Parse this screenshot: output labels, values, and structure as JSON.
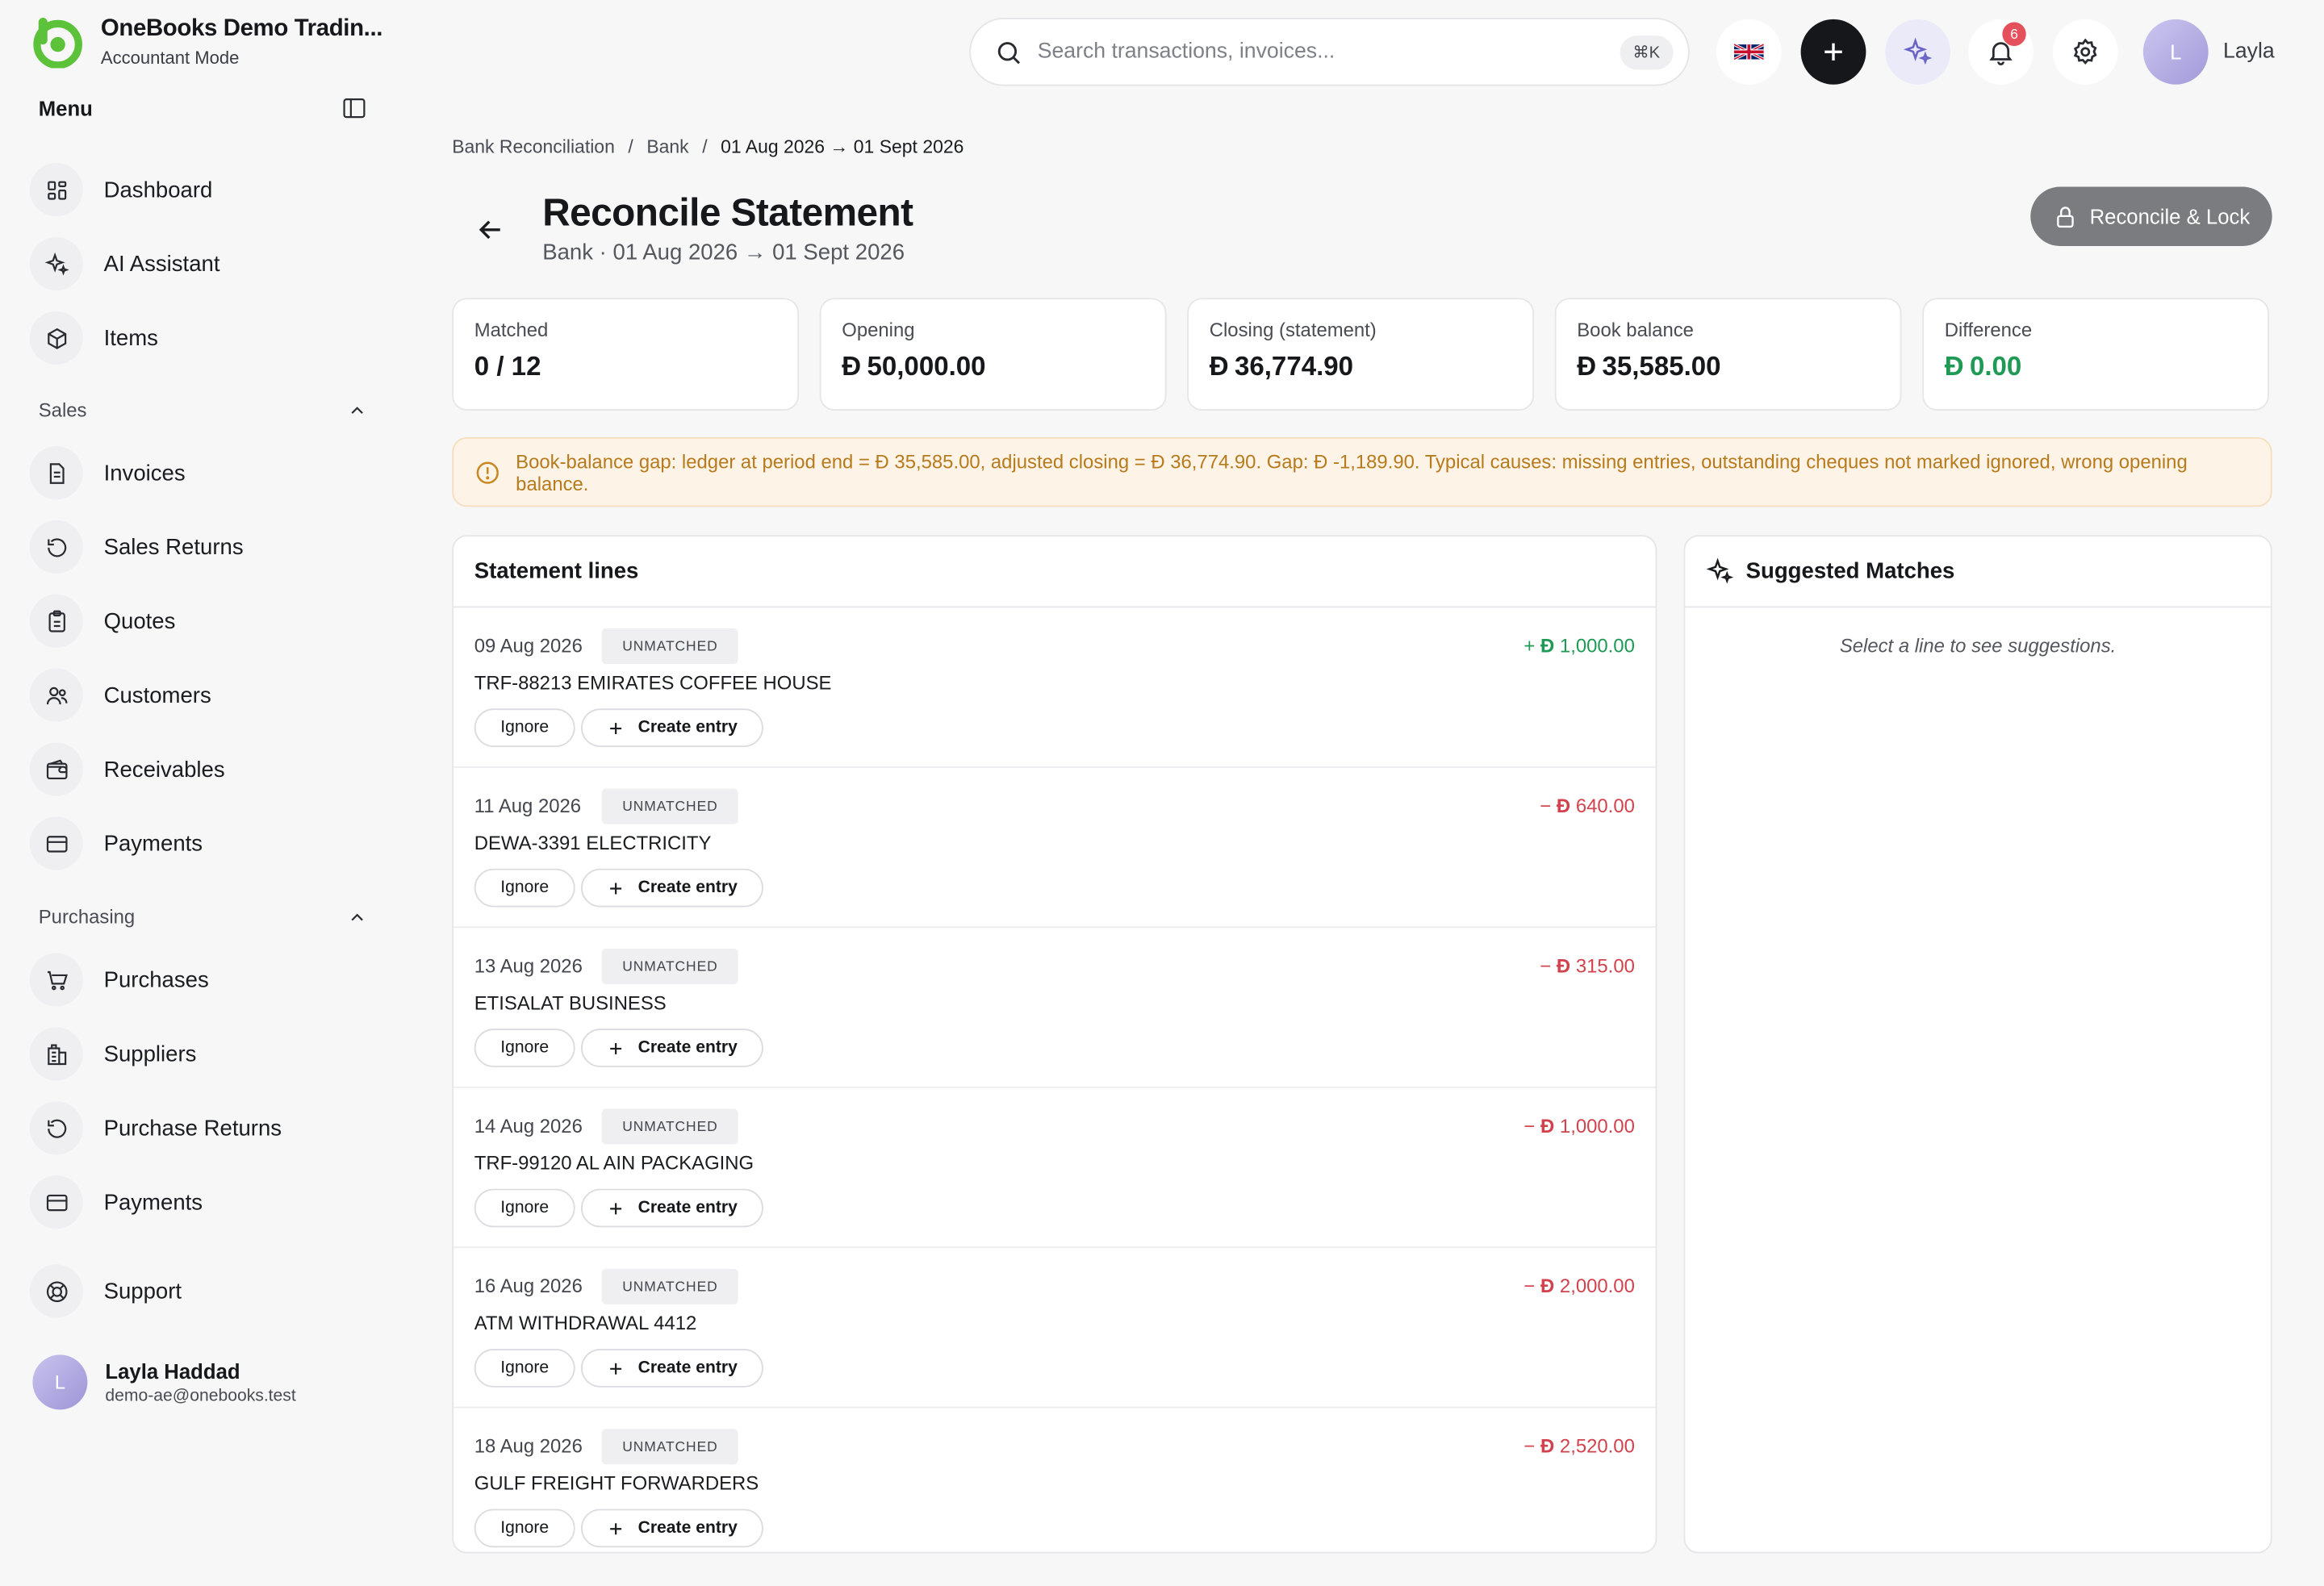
{
  "brand": {
    "name": "OneBooks Demo Tradin...",
    "mode": "Accountant Mode"
  },
  "sidebar": {
    "menu_title": "Menu",
    "main_items": [
      {
        "label": "Dashboard",
        "icon": "dashboard-icon"
      },
      {
        "label": "AI Assistant",
        "icon": "sparkles-icon"
      },
      {
        "label": "Items",
        "icon": "box-icon"
      }
    ],
    "sales": {
      "title": "Sales",
      "items": [
        {
          "label": "Invoices",
          "icon": "document-icon"
        },
        {
          "label": "Sales Returns",
          "icon": "return-icon"
        },
        {
          "label": "Quotes",
          "icon": "clipboard-icon"
        },
        {
          "label": "Customers",
          "icon": "users-icon"
        },
        {
          "label": "Receivables",
          "icon": "wallet-icon"
        },
        {
          "label": "Payments",
          "icon": "card-icon"
        }
      ]
    },
    "purchasing": {
      "title": "Purchasing",
      "items": [
        {
          "label": "Purchases",
          "icon": "cart-icon"
        },
        {
          "label": "Suppliers",
          "icon": "building-icon"
        },
        {
          "label": "Purchase Returns",
          "icon": "return-icon"
        },
        {
          "label": "Payments",
          "icon": "card-icon"
        }
      ]
    },
    "support_label": "Support",
    "user": {
      "initial": "L",
      "name": "Layla Haddad",
      "email": "demo-ae@onebooks.test"
    }
  },
  "topbar": {
    "search_placeholder": "Search transactions, invoices...",
    "shortcut": "⌘K",
    "notification_count": "6",
    "user_initial": "L",
    "user_name": "Layla"
  },
  "breadcrumb": {
    "items": [
      "Bank Reconciliation",
      "Bank"
    ],
    "separator": "/",
    "current": "01 Aug 2026 → 01 Sept 2026"
  },
  "page": {
    "title": "Reconcile Statement",
    "subtitle": "Bank · 01 Aug 2026 → 01 Sept 2026",
    "action_label": "Reconcile & Lock"
  },
  "currency_symbol": "Đ",
  "stats": [
    {
      "label": "Matched",
      "value": "0 / 12",
      "currency": false
    },
    {
      "label": "Opening",
      "value": "50,000.00",
      "currency": true
    },
    {
      "label": "Closing (statement)",
      "value": "36,774.90",
      "currency": true
    },
    {
      "label": "Book balance",
      "value": "35,585.00",
      "currency": true
    },
    {
      "label": "Difference",
      "value": "0.00",
      "currency": true,
      "color": "#1f9a55"
    }
  ],
  "alert": {
    "text": "Book-balance gap: ledger at period end = Đ 35,585.00, adjusted closing = Đ 36,774.90. Gap: Đ -1,189.90. Typical causes: missing entries, outstanding cheques not marked ignored, wrong opening balance."
  },
  "statement": {
    "title": "Statement lines",
    "ignore_label": "Ignore",
    "create_label": "Create entry",
    "lines": [
      {
        "date": "09 Aug 2026",
        "status": "UNMATCHED",
        "desc": "TRF-88213 EMIRATES COFFEE HOUSE",
        "sign": "+",
        "amount": "1,000.00",
        "positive": true
      },
      {
        "date": "11 Aug 2026",
        "status": "UNMATCHED",
        "desc": "DEWA-3391 ELECTRICITY",
        "sign": "−",
        "amount": "640.00",
        "positive": false
      },
      {
        "date": "13 Aug 2026",
        "status": "UNMATCHED",
        "desc": "ETISALAT BUSINESS",
        "sign": "−",
        "amount": "315.00",
        "positive": false
      },
      {
        "date": "14 Aug 2026",
        "status": "UNMATCHED",
        "desc": "TRF-99120 AL AIN PACKAGING",
        "sign": "−",
        "amount": "1,000.00",
        "positive": false
      },
      {
        "date": "16 Aug 2026",
        "status": "UNMATCHED",
        "desc": "ATM WITHDRAWAL 4412",
        "sign": "−",
        "amount": "2,000.00",
        "positive": false
      },
      {
        "date": "18 Aug 2026",
        "status": "UNMATCHED",
        "desc": "GULF FREIGHT FORWARDERS",
        "sign": "−",
        "amount": "2,520.00",
        "positive": false
      }
    ]
  },
  "suggestions": {
    "title": "Suggested Matches",
    "empty": "Select a line to see suggestions."
  },
  "colors": {
    "accent": "#16171b",
    "positive": "#1f9a55",
    "negative": "#d2424d",
    "warning": "#b77a1c",
    "brand": "#5cc23a"
  }
}
